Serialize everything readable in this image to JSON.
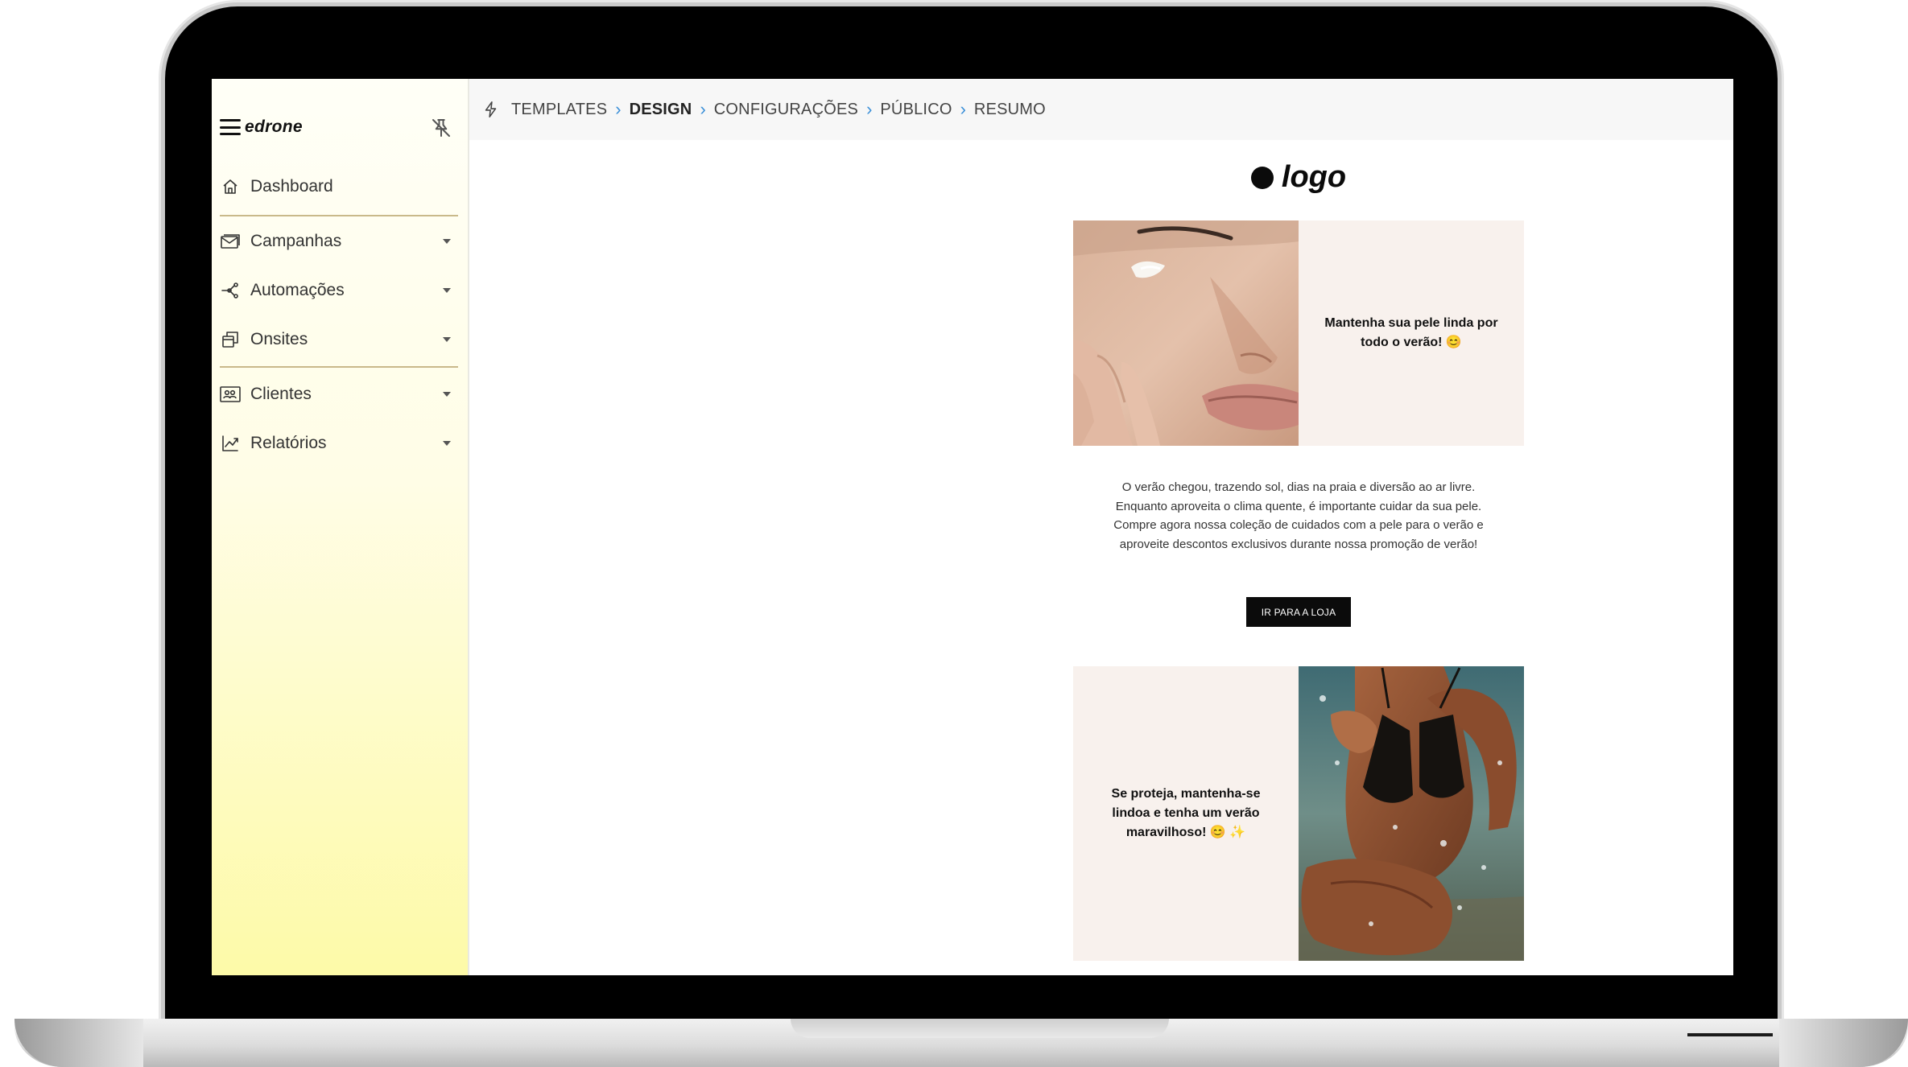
{
  "sidebar": {
    "brand": "edrone",
    "items": [
      {
        "label": "Dashboard",
        "icon": "home-icon"
      },
      {
        "label": "Campanhas",
        "icon": "mail-icon"
      },
      {
        "label": "Automações",
        "icon": "share-icon"
      },
      {
        "label": "Onsites",
        "icon": "windows-icon"
      },
      {
        "label": "Clientes",
        "icon": "contacts-icon"
      },
      {
        "label": "Relatórios",
        "icon": "trend-chart-icon"
      }
    ]
  },
  "breadcrumb": {
    "steps": [
      "TEMPLATES",
      "DESIGN",
      "CONFIGURAÇÕES",
      "PÚBLICO",
      "RESUMO"
    ],
    "active": "DESIGN"
  },
  "email": {
    "logo_text": "logo",
    "hero_text": "Mantenha sua pele linda por todo o verão! 😊",
    "body_lines": [
      "O verão chegou, trazendo sol, dias na praia e diversão ao ar livre.",
      "Enquanto aproveita o clima quente, é importante cuidar da sua pele.",
      "Compre agora nossa coleção de cuidados com a pele para o verão e aproveite descontos exclusivos durante nossa promoção de verão!"
    ],
    "cta_label": "IR PARA A LOJA",
    "second_text": "Se proteja, mantenha-se lindoa e tenha um verão maravilhoso! 😊 ✨"
  },
  "colors": {
    "accent_blue": "#3a8fd8",
    "sidebar_top": "#fffff7",
    "sidebar_bottom": "#fdfaa8",
    "panel_bg": "#f8f1ed",
    "cta_bg": "#0b0b0b"
  }
}
